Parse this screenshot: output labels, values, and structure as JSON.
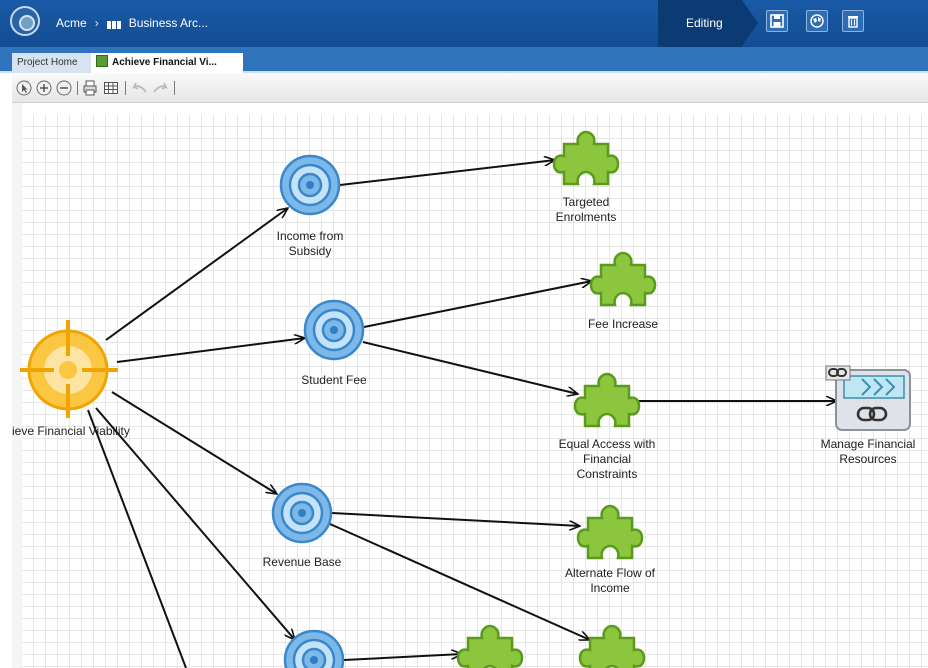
{
  "header": {
    "breadcrumb": [
      "Acme",
      "Business Arc..."
    ],
    "mode_label": "Editing",
    "actions": [
      {
        "name": "save-button",
        "icon": "floppy-disk-icon"
      },
      {
        "name": "publish-button",
        "icon": "globe-icon"
      },
      {
        "name": "delete-button",
        "icon": "trash-icon"
      }
    ]
  },
  "tabs": [
    {
      "label": "Project Home",
      "active": false
    },
    {
      "label": "Achieve Financial Vi...",
      "active": true,
      "icon": "diagram-icon"
    }
  ],
  "toolbar": {
    "tools": [
      "select-icon",
      "zoom-in-icon",
      "zoom-out-icon",
      "print-icon",
      "grid-icon",
      "undo-icon",
      "redo-icon"
    ]
  },
  "diagram": {
    "nodes": [
      {
        "id": "root",
        "type": "goal",
        "label": "ieve Financial Viability"
      },
      {
        "id": "income_subsidy",
        "type": "objective",
        "label": "Income from\nSubsidy"
      },
      {
        "id": "student_fee",
        "type": "objective",
        "label": "Student Fee"
      },
      {
        "id": "revenue_base",
        "type": "objective",
        "label": "Revenue Base"
      },
      {
        "id": "objective_4",
        "type": "objective",
        "label": ""
      },
      {
        "id": "targeted_enrolments",
        "type": "strategy",
        "label": "Targeted\nEnrolments"
      },
      {
        "id": "fee_increase",
        "type": "strategy",
        "label": "Fee Increase"
      },
      {
        "id": "equal_access",
        "type": "strategy",
        "label": "Equal Access with\nFinancial\nConstraints"
      },
      {
        "id": "alternate_flow",
        "type": "strategy",
        "label": "Alternate Flow of\nIncome"
      },
      {
        "id": "strategy_5",
        "type": "strategy",
        "label": ""
      },
      {
        "id": "strategy_6",
        "type": "strategy",
        "label": ""
      },
      {
        "id": "manage_financial",
        "type": "capability",
        "label": "Manage Financial\nResources"
      }
    ],
    "edges": [
      [
        "root",
        "income_subsidy"
      ],
      [
        "root",
        "student_fee"
      ],
      [
        "root",
        "revenue_base"
      ],
      [
        "root",
        "objective_4"
      ],
      [
        "income_subsidy",
        "targeted_enrolments"
      ],
      [
        "student_fee",
        "fee_increase"
      ],
      [
        "student_fee",
        "equal_access"
      ],
      [
        "equal_access",
        "manage_financial"
      ],
      [
        "revenue_base",
        "alternate_flow"
      ],
      [
        "revenue_base",
        "strategy_6"
      ],
      [
        "objective_4",
        "strategy_5"
      ]
    ],
    "colors": {
      "goal": "#f5b52e",
      "objective": "#7db9e8",
      "strategy": "#8cc63f",
      "capability": "#d9dde2",
      "header": "#1a5aa6"
    }
  }
}
